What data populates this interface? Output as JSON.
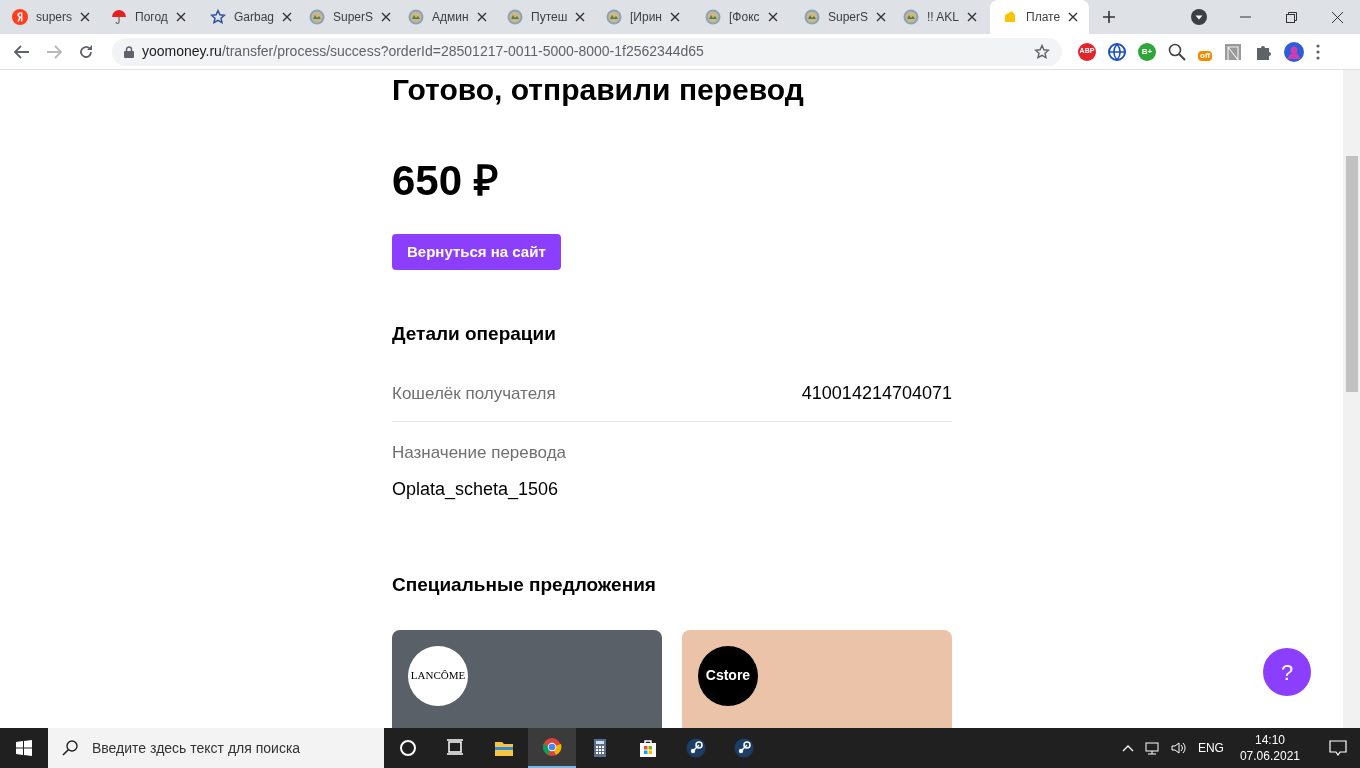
{
  "browser": {
    "tabs": [
      {
        "title": "supers",
        "kind": "yandex",
        "selected": false
      },
      {
        "title": "Погод",
        "kind": "umbrella",
        "selected": false
      },
      {
        "title": "Garbag",
        "kind": "star",
        "selected": false
      },
      {
        "title": "SuperS",
        "kind": "globe",
        "selected": false
      },
      {
        "title": "Админ",
        "kind": "globe",
        "selected": false
      },
      {
        "title": "Путеш",
        "kind": "globe",
        "selected": false
      },
      {
        "title": "[Ирин",
        "kind": "globe",
        "selected": false
      },
      {
        "title": "[Фокс",
        "kind": "globe",
        "selected": false
      },
      {
        "title": "SuperS",
        "kind": "globe",
        "selected": false
      },
      {
        "title": "!! AKL",
        "kind": "globe",
        "selected": false
      },
      {
        "title": "Плате",
        "kind": "wallet",
        "selected": true
      }
    ],
    "url_host": "yoomoney.ru",
    "url_path": "/transfer/process/success?orderId=28501217-0011-5000-8000-1f2562344d65",
    "extensions": [
      {
        "kind": "abp",
        "label": "ABP"
      },
      {
        "kind": "globe"
      },
      {
        "kind": "badge",
        "label": "B+"
      },
      {
        "kind": "magnifier"
      },
      {
        "kind": "off",
        "label": "off"
      },
      {
        "kind": "bridge"
      },
      {
        "kind": "puzzle"
      },
      {
        "kind": "avatar"
      }
    ]
  },
  "page": {
    "title": "Готово, отправили перевод",
    "amount": "650 ₽",
    "back_button": "Вернуться на сайт",
    "details_heading": "Детали операции",
    "details": [
      {
        "label": "Кошелёк получателя",
        "value": "410014214704071",
        "kind": "inline"
      },
      {
        "label": "Назначение перевода",
        "value": "Oplata_scheta_1506",
        "kind": "stacked"
      }
    ],
    "offers_heading": "Специальные предложения",
    "offers": [
      {
        "logo": "LANCÔME",
        "kind": "beauty"
      },
      {
        "logo": "Cstore",
        "kind": "phone"
      }
    ],
    "help_button": "?"
  },
  "taskbar": {
    "search_placeholder": "Введите здесь текст для поиска",
    "apps": [
      {
        "kind": "cortana",
        "selected": false
      },
      {
        "kind": "taskview",
        "selected": false
      },
      {
        "kind": "folder",
        "selected": false
      },
      {
        "kind": "chrome",
        "selected": true
      },
      {
        "kind": "calculator",
        "selected": false
      },
      {
        "kind": "store",
        "selected": false
      },
      {
        "kind": "steam",
        "selected": false
      },
      {
        "kind": "steam",
        "selected": false
      }
    ],
    "language": "ENG",
    "time": "14:10",
    "date": "07.06.2021"
  }
}
